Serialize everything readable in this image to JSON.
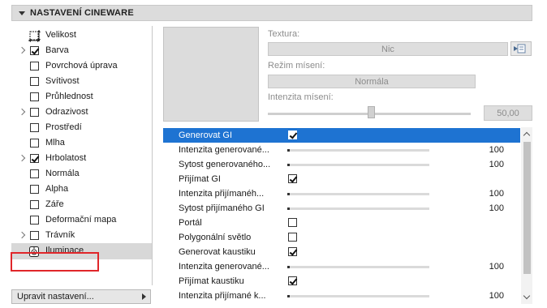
{
  "panel": {
    "title": "NASTAVENÍ CINEWARE"
  },
  "channels": [
    {
      "label": "Velikost",
      "kind": "icon",
      "icon": "resize-icon",
      "expander": false,
      "checked": false
    },
    {
      "label": "Barva",
      "kind": "checkbox",
      "expander": true,
      "checked": true
    },
    {
      "label": "Povrchová úprava",
      "kind": "checkbox",
      "expander": false,
      "checked": false
    },
    {
      "label": "Svítivost",
      "kind": "checkbox",
      "expander": false,
      "checked": false
    },
    {
      "label": "Průhlednost",
      "kind": "checkbox",
      "expander": false,
      "checked": false
    },
    {
      "label": "Odrazivost",
      "kind": "checkbox",
      "expander": true,
      "checked": false
    },
    {
      "label": "Prostředí",
      "kind": "checkbox",
      "expander": false,
      "checked": false
    },
    {
      "label": "Mlha",
      "kind": "checkbox",
      "expander": false,
      "checked": false
    },
    {
      "label": "Hrbolatost",
      "kind": "checkbox",
      "expander": true,
      "checked": true
    },
    {
      "label": "Normála",
      "kind": "checkbox",
      "expander": false,
      "checked": false
    },
    {
      "label": "Alpha",
      "kind": "checkbox",
      "expander": false,
      "checked": false
    },
    {
      "label": "Záře",
      "kind": "checkbox",
      "expander": false,
      "checked": false
    },
    {
      "label": "Deformační mapa",
      "kind": "checkbox",
      "expander": false,
      "checked": false
    },
    {
      "label": "Trávník",
      "kind": "checkbox",
      "expander": true,
      "checked": false
    },
    {
      "label": "Iluminace",
      "kind": "icon",
      "icon": "illumination-icon",
      "expander": false,
      "checked": false,
      "selected": true
    }
  ],
  "edit_button": {
    "label": "Upravit nastavení..."
  },
  "texture": {
    "label": "Textura:",
    "value": "Nic",
    "blend_mode_label": "Režim mísení:",
    "blend_mode_value": "Normála",
    "blend_intensity_label": "Intenzita mísení:",
    "blend_intensity_value": "50,00",
    "blend_intensity_fraction": 0.5
  },
  "params": [
    {
      "label": "Generovat GI",
      "type": "checkbox",
      "checked": true,
      "selected": true
    },
    {
      "label": "Intenzita generované...",
      "type": "slider",
      "value": "100",
      "fraction": 0.01
    },
    {
      "label": "Sytost generovaného...",
      "type": "slider",
      "value": "100",
      "fraction": 0.01
    },
    {
      "label": "Přijímat GI",
      "type": "checkbox",
      "checked": true
    },
    {
      "label": "Intenzita přijímanéh...",
      "type": "slider",
      "value": "100",
      "fraction": 0.01
    },
    {
      "label": "Sytost přijímaného GI",
      "type": "slider",
      "value": "100",
      "fraction": 0.01
    },
    {
      "label": "Portál",
      "type": "checkbox",
      "checked": false
    },
    {
      "label": "Polygonální světlo",
      "type": "checkbox",
      "checked": false
    },
    {
      "label": "Generovat kaustiku",
      "type": "checkbox",
      "checked": true
    },
    {
      "label": "Intenzita generované...",
      "type": "slider",
      "value": "100",
      "fraction": 0.01
    },
    {
      "label": "Přijímat kaustiku",
      "type": "checkbox",
      "checked": true
    },
    {
      "label": "Intenzita přijímané k...",
      "type": "slider",
      "value": "100",
      "fraction": 0.01
    }
  ],
  "colors": {
    "selection": "#1e73d2",
    "highlight_border": "#e0262a"
  }
}
